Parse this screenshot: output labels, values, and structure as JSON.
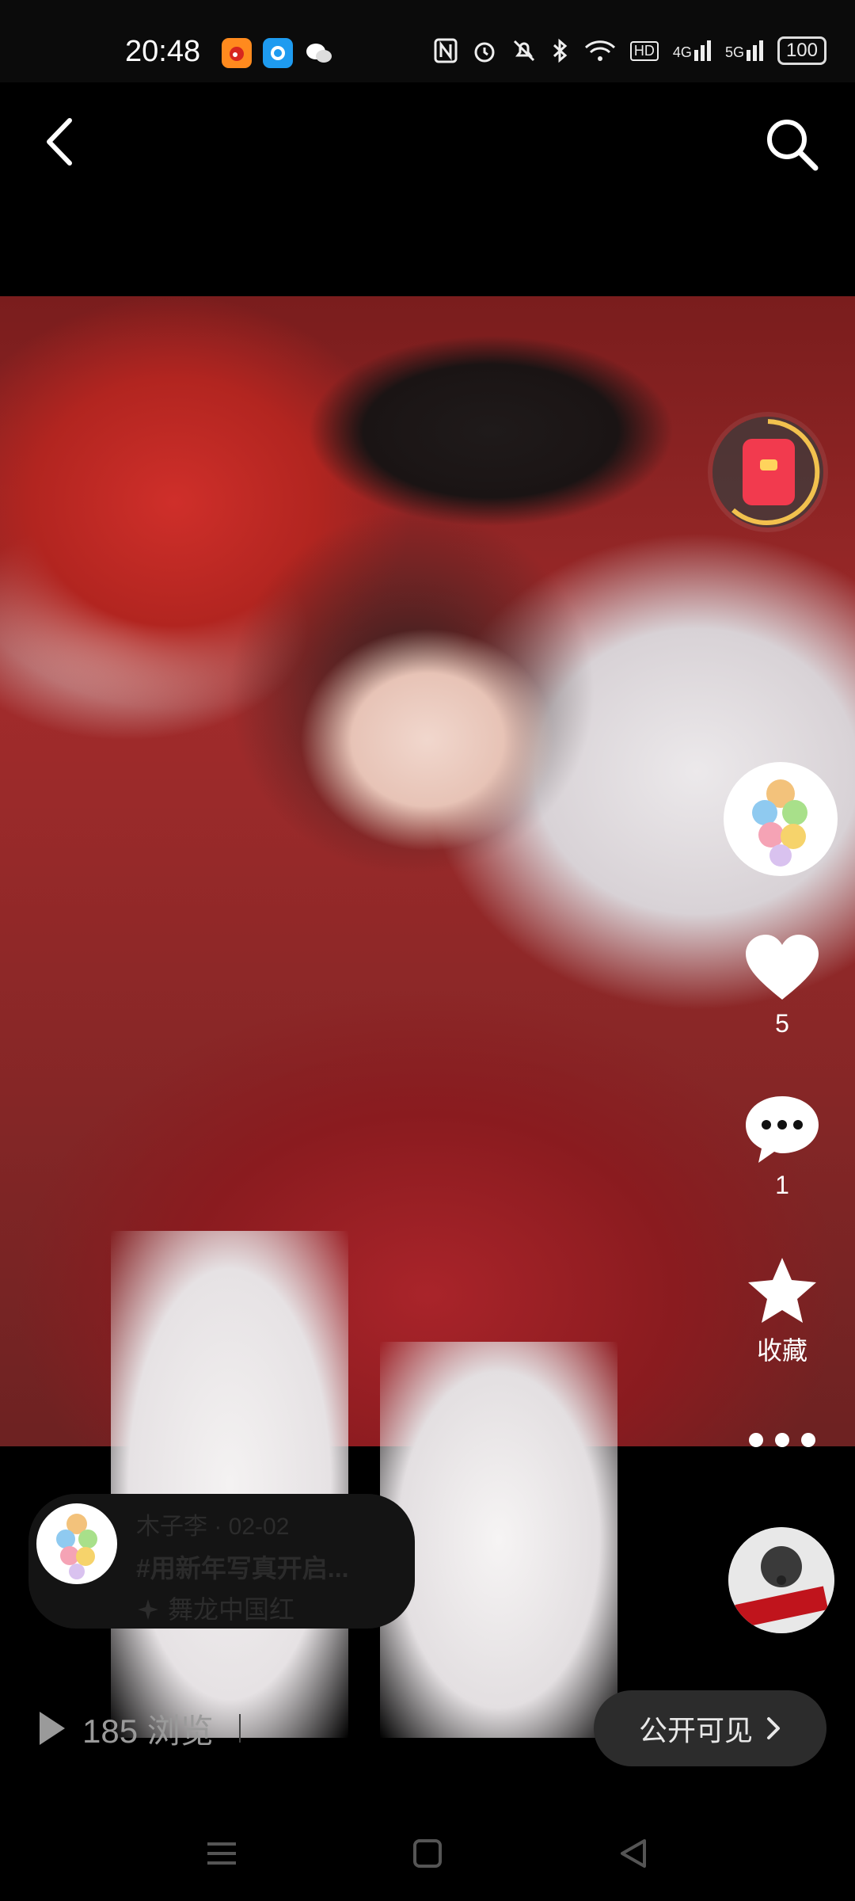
{
  "status_bar": {
    "time": "20:48",
    "app_icons": [
      "weibo-icon",
      "qq-icon",
      "wechat-icon"
    ],
    "right_icons": [
      "nfc-icon",
      "alarm-icon",
      "mute-icon",
      "bluetooth-icon",
      "wifi-icon",
      "hd-icon",
      "signal-4g-icon",
      "signal-5g-icon"
    ],
    "hd_label": "HD",
    "signal_4g_label": "4G",
    "signal_5g_label": "5G",
    "battery": "100"
  },
  "header": {
    "back_icon": "chevron-left-icon",
    "search_icon": "search-icon"
  },
  "actions": {
    "likes": "5",
    "comments": "1",
    "collect_label": "收藏",
    "more_icon": "more-dots-icon"
  },
  "post_info": {
    "author_date": "木子李 · 02-02",
    "hashtag": "#用新年写真开启...",
    "music": "舞龙中国红"
  },
  "footer": {
    "views": "185 浏览",
    "visibility_label": "公开可见"
  },
  "nav": {
    "icons": [
      "menu-icon",
      "home-square-icon",
      "back-triangle-icon"
    ]
  },
  "colors": {
    "background": "#000000",
    "accent_gold": "#f2c14e",
    "red_packet": "#f23a4e"
  }
}
